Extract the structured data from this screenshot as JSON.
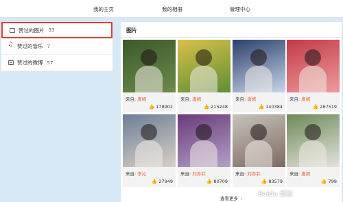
{
  "topnav": [
    "我的主页",
    "我的相册",
    "管理中心"
  ],
  "sidebar": [
    {
      "label": "赞过的图片",
      "count": "33"
    },
    {
      "label": "赞过的音乐",
      "count": "7"
    },
    {
      "label": "赞过的微博",
      "count": "57"
    }
  ],
  "panel": {
    "title": "图片",
    "more": "查看更多"
  },
  "cards": [
    {
      "from": "来自:",
      "author": "唐嫣",
      "likes": "178902",
      "colors": [
        "#3a5a2a",
        "#6e8a4b"
      ]
    },
    {
      "from": "来自:",
      "author": "唐嫣",
      "likes": "215248",
      "colors": [
        "#d8c04a",
        "#5e8f34"
      ]
    },
    {
      "from": "来自:",
      "author": "唐嫣",
      "likes": "140384",
      "colors": [
        "#2b3f6a",
        "#c8d6ea"
      ]
    },
    {
      "from": "来自:",
      "author": "唐嫣",
      "likes": "287519",
      "colors": [
        "#c23a4a",
        "#ee9a9a"
      ]
    },
    {
      "from": "来自:",
      "author": "李沁",
      "likes": "27949",
      "colors": [
        "#6c7f98",
        "#d8d0c6"
      ]
    },
    {
      "from": "来自:",
      "author": "刘亦菲",
      "likes": "80709",
      "colors": [
        "#6a3a7a",
        "#b3a0c8"
      ]
    },
    {
      "from": "来自:",
      "author": "刘亦菲",
      "likes": "83579",
      "colors": [
        "#c7c3bc",
        "#7e6a60"
      ]
    },
    {
      "from": "来自:",
      "author": "唐嫣",
      "likes": "798",
      "colors": [
        "#6a8a5a",
        "#e6e3dc"
      ]
    }
  ],
  "watermark": "Baidu 经验",
  "icons": {
    "likes": "thumbs-up-icon"
  }
}
